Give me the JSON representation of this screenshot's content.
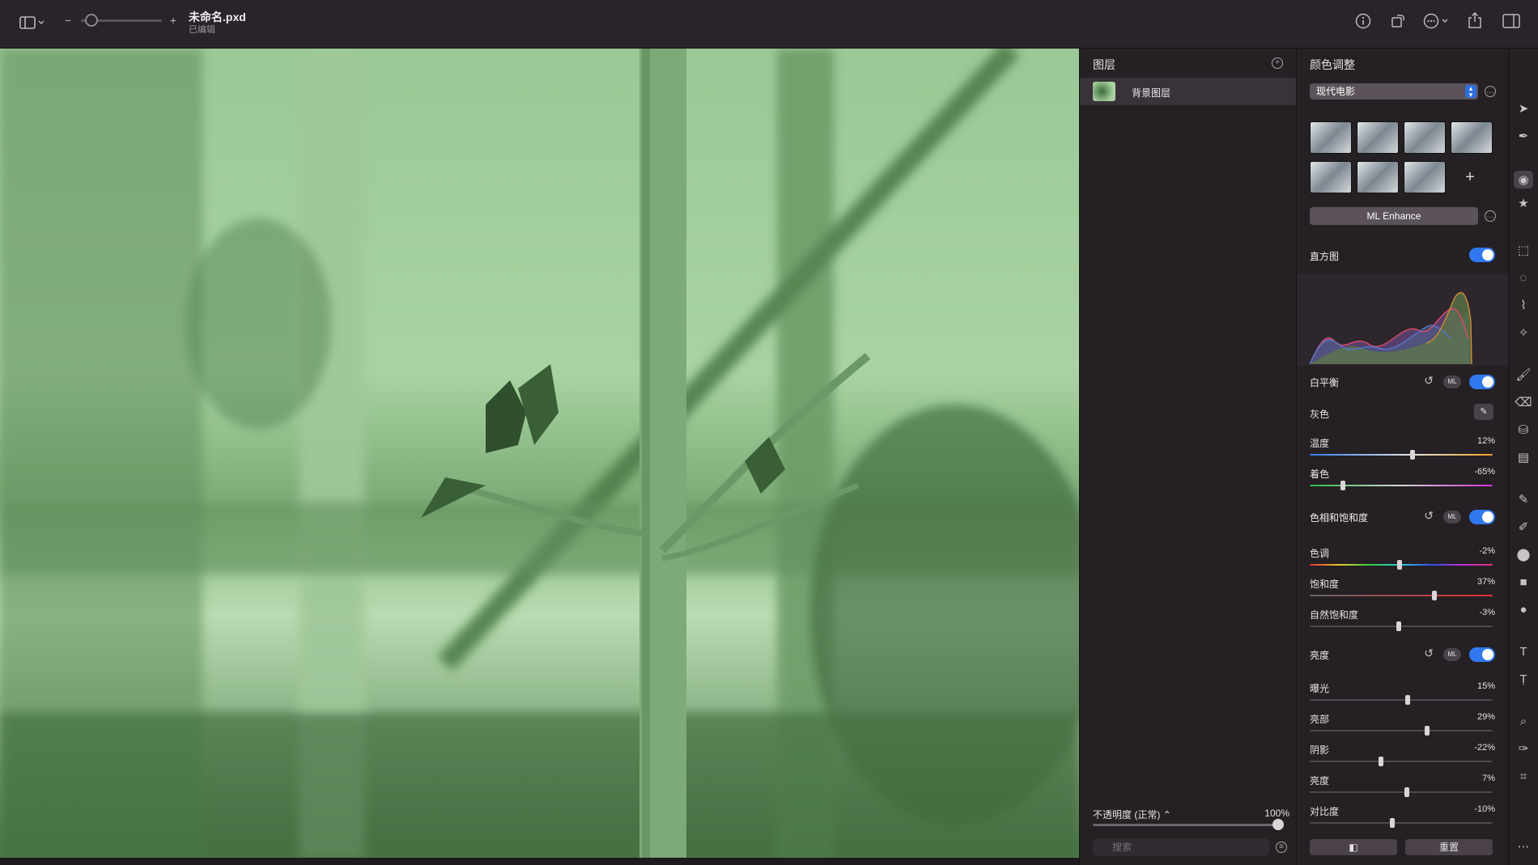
{
  "titlebar": {
    "document_title": "未命名.pxd",
    "document_status": "已编辑",
    "zoom_minus": "−",
    "zoom_plus": "+"
  },
  "layers_panel": {
    "title": "图层",
    "layers": [
      {
        "name": "背景图层"
      }
    ],
    "opacity_label": "不透明度 (正常) ⌃",
    "opacity_value": "100%",
    "opacity_fraction": 1.0,
    "search_placeholder": "搜索"
  },
  "adjustments_panel": {
    "title": "颜色调整",
    "preset_name": "现代电影",
    "preset_count": 7,
    "add_preset_label": "+",
    "ml_enhance_label": "ML Enhance",
    "ml_badge": "ML",
    "histogram": {
      "title": "直方图",
      "enabled": true
    },
    "white_balance": {
      "title": "白平衡",
      "enabled": true,
      "gray_label": "灰色",
      "sliders": [
        {
          "label": "温度",
          "value": "12%",
          "fraction": 0.56
        },
        {
          "label": "着色",
          "value": "-65%",
          "fraction": 0.18
        }
      ]
    },
    "hue_saturation": {
      "title": "色相和饱和度",
      "enabled": true,
      "sliders": [
        {
          "label": "色调",
          "value": "-2%",
          "fraction": 0.49
        },
        {
          "label": "饱和度",
          "value": "37%",
          "fraction": 0.68
        },
        {
          "label": "自然饱和度",
          "value": "-3%",
          "fraction": 0.485
        }
      ]
    },
    "lightness": {
      "title": "亮度",
      "enabled": true,
      "sliders": [
        {
          "label": "曝光",
          "value": "15%",
          "fraction": 0.535
        },
        {
          "label": "亮部",
          "value": "29%",
          "fraction": 0.64
        },
        {
          "label": "阴影",
          "value": "-22%",
          "fraction": 0.39
        },
        {
          "label": "亮度",
          "value": "7%",
          "fraction": 0.53
        },
        {
          "label": "对比度",
          "value": "-10%",
          "fraction": 0.45
        }
      ]
    },
    "reset_label": "重置"
  },
  "colors": {
    "accent": "#2f78f0",
    "panel_bg": "#252024",
    "canvas_tint": "#6b9a68"
  }
}
